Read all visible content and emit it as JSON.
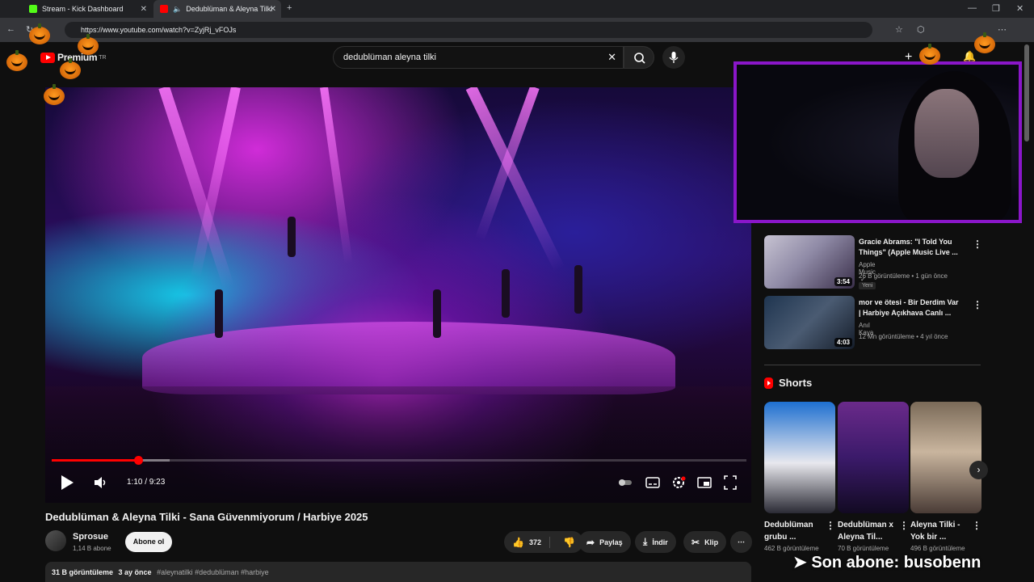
{
  "browser": {
    "tabs": [
      {
        "label": "Stream - Kick Dashboard",
        "favicon_color": "#53fc18"
      },
      {
        "label": "Dedublüman & Aleyna Tilki",
        "favicon_color": "#ff0000"
      }
    ],
    "url": "https://www.youtube.com/watch?v=ZyjRj_vFOJs"
  },
  "youtube": {
    "logo_text": "Premium",
    "logo_region": "TR",
    "search_query": "dedublüman aleyna tilki"
  },
  "player": {
    "time_display": "1:10 / 9:23",
    "progress_fraction": 0.124,
    "buffered_fraction": 0.17
  },
  "video": {
    "title": "Dedublüman & Aleyna Tilki - Sana Güvenmiyorum / Harbiye 2025",
    "channel": "Sprosue",
    "subscribers": "1,14 B abone",
    "subscribe_label": "Abone ol",
    "like_count": "372",
    "share_label": "Paylaş",
    "download_label": "İndir",
    "clip_label": "Klip",
    "views": "31 B görüntüleme",
    "age": "3 ay önce",
    "hashtags": "#aleynatilki #dedublüman #harbiye"
  },
  "recommendations": [
    {
      "title": "Gracie Abrams: \"I Told You Things\" (Apple Music Live ...",
      "channel": "Apple Music",
      "meta": "26 B görüntüleme • 1 gün önce",
      "badge": "Yeni",
      "duration": "3:54"
    },
    {
      "title": "mor ve ötesi - Bir Derdim Var | Harbiye Açıkhava Canlı ...",
      "channel": "Anıl Kaya",
      "meta": "12 Mn görüntüleme • 4 yıl önce",
      "badge": "",
      "duration": "4:03"
    }
  ],
  "shorts": {
    "heading": "Shorts",
    "items": [
      {
        "title": "Dedublüman grubu ...",
        "views": "462 B görüntüleme"
      },
      {
        "title": "Dedublüman x Aleyna Til...",
        "views": "70 B görüntüleme"
      },
      {
        "title": "Aleyna Tilki - Yok bir ...",
        "views": "496 B görüntüleme"
      }
    ]
  },
  "overlay": {
    "banner": "➤ Son abone: busobenn"
  },
  "colors": {
    "accent": "#ff0000",
    "webcam_border": "#8a16c9",
    "background": "#0f0f0f"
  }
}
